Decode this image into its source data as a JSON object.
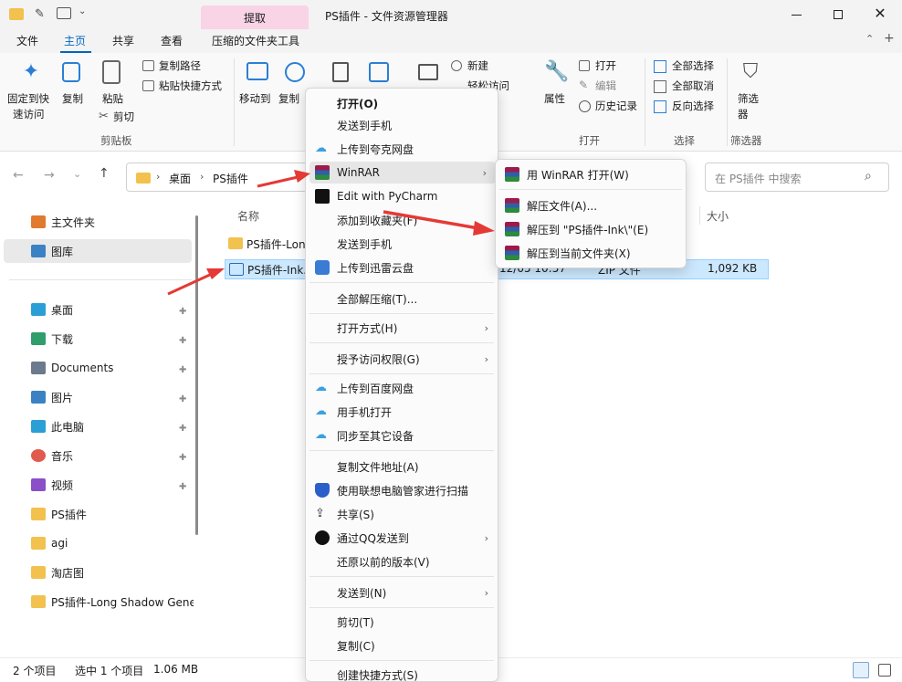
{
  "window": {
    "title": "PS插件 - 文件资源管理器",
    "context_tab": "提取"
  },
  "ribbon_tabs": [
    "文件",
    "主页",
    "共享",
    "查看",
    "压缩的文件夹工具"
  ],
  "ribbon": {
    "pin_quick": "固定到快速访问",
    "pin_quick_l1": "固定到快",
    "pin_quick_l2": "速访问",
    "copy": "复制",
    "paste": "粘贴",
    "copy_path": "复制路径",
    "paste_shortcut": "粘贴快捷方式",
    "cut": "剪切",
    "group_clipboard": "剪贴板",
    "move_to": "移动到",
    "copy_to": "复制",
    "new": "新建",
    "easy_access": "轻松访问",
    "properties": "属性",
    "open": "打开",
    "edit": "编辑",
    "history": "历史记录",
    "group_open": "打开",
    "select_all": "全部选择",
    "select_none": "全部取消",
    "invert": "反向选择",
    "group_select": "选择",
    "filter": "筛选器",
    "filter_l1": "筛选",
    "filter_l2": "器",
    "group_filter": "筛选器"
  },
  "nav": {
    "crumb_1": "桌面",
    "crumb_2": "PS插件",
    "search_placeholder": "在 PS插件 中搜索"
  },
  "sidebar": {
    "items": [
      {
        "label": "主文件夹",
        "color": "#e07a2e"
      },
      {
        "label": "图库",
        "color": "#3b82c4"
      },
      {
        "label": "桌面",
        "color": "#2a9fd6"
      },
      {
        "label": "下载",
        "color": "#2f9e6b"
      },
      {
        "label": "Documents",
        "color": "#6b7a8c"
      },
      {
        "label": "图片",
        "color": "#3b82c4"
      },
      {
        "label": "此电脑",
        "color": "#2a9fd6"
      },
      {
        "label": "音乐",
        "color": "#e05a4e"
      },
      {
        "label": "视频",
        "color": "#8b4fc7"
      },
      {
        "label": "PS插件",
        "color": "#f2c14e"
      },
      {
        "label": "agi",
        "color": "#f2c14e"
      },
      {
        "label": "淘店图",
        "color": "#f2c14e"
      },
      {
        "label": "PS插件-Long Shadow Gene",
        "color": "#f2c14e"
      }
    ]
  },
  "file_list": {
    "col_name": "名称",
    "col_size": "大小",
    "rows": [
      {
        "name": "PS插件-Lon",
        "date": "",
        "type": "",
        "size": ""
      },
      {
        "name": "PS插件-Ink.",
        "date": "12/05 10:57",
        "type": "ZIP 文件",
        "size": "1,092 KB"
      }
    ]
  },
  "context_menu": {
    "items": [
      {
        "label": "打开(O)",
        "bold": true
      },
      {
        "label": "发送到手机"
      },
      {
        "label": "上传到夸克网盘"
      },
      {
        "label": "WinRAR",
        "submenu": true
      },
      {
        "label": "Edit with PyCharm"
      },
      {
        "label": "添加到收藏夹(F)"
      },
      {
        "label": "发送到手机"
      },
      {
        "label": "上传到迅雷云盘"
      },
      {
        "label": "全部解压缩(T)..."
      },
      {
        "label": "打开方式(H)",
        "submenu": true
      },
      {
        "label": "授予访问权限(G)",
        "submenu": true
      },
      {
        "label": "上传到百度网盘"
      },
      {
        "label": "用手机打开"
      },
      {
        "label": "同步至其它设备"
      },
      {
        "label": "复制文件地址(A)"
      },
      {
        "label": "使用联想电脑管家进行扫描"
      },
      {
        "label": "共享(S)"
      },
      {
        "label": "通过QQ发送到",
        "submenu": true
      },
      {
        "label": "还原以前的版本(V)"
      },
      {
        "label": "发送到(N)",
        "submenu": true
      },
      {
        "label": "剪切(T)"
      },
      {
        "label": "复制(C)"
      },
      {
        "label": "创建快捷方式(S)"
      }
    ]
  },
  "winrar_submenu": {
    "items": [
      {
        "label": "用 WinRAR 打开(W)"
      },
      {
        "label": "解压文件(A)..."
      },
      {
        "label": "解压到 \"PS插件-Ink\\\"(E)"
      },
      {
        "label": "解压到当前文件夹(X)"
      }
    ]
  },
  "status": {
    "count": "2 个项目",
    "selected": "选中 1 个项目",
    "size": "1.06 MB"
  },
  "colors": {
    "accent": "#0067c0",
    "selection": "#cce8ff",
    "context_tab": "#f9d3e6",
    "arrow": "#e53935"
  }
}
